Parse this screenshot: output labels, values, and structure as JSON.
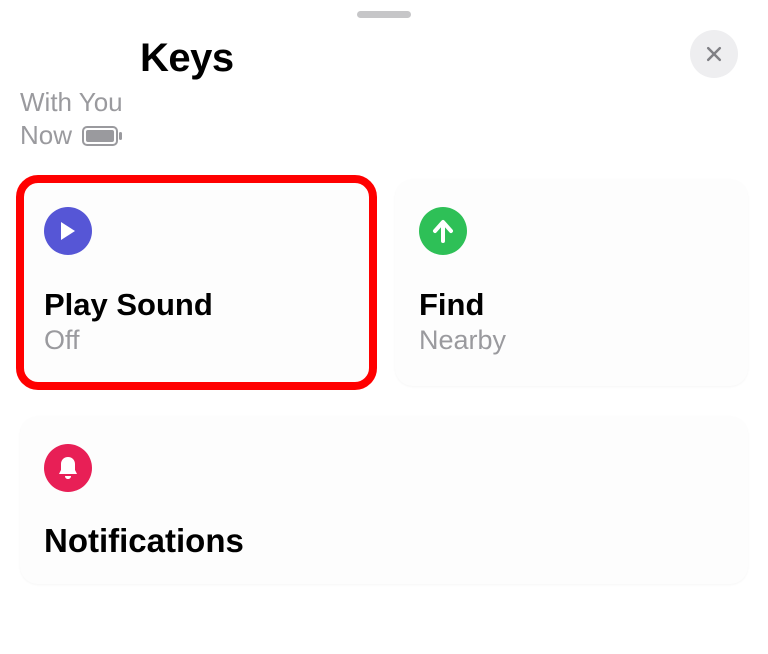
{
  "header": {
    "title": "Keys",
    "status": "With You",
    "now": "Now"
  },
  "cards": {
    "playSound": {
      "title": "Play Sound",
      "sub": "Off"
    },
    "find": {
      "title": "Find",
      "sub": "Nearby"
    }
  },
  "section": {
    "notifications": "Notifications"
  },
  "colors": {
    "playIcon": "#5656d6",
    "findIcon": "#2ec057",
    "bellIcon": "#e81f56",
    "highlight": "#ff0000"
  }
}
